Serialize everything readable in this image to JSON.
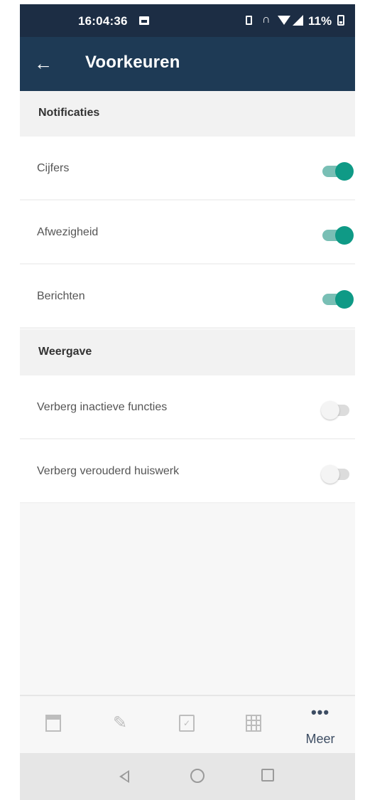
{
  "status_bar": {
    "time": "16:04:36",
    "battery": "11%",
    "icons": [
      "image-icon",
      "vibrate-icon",
      "headset-icon",
      "wifi-icon",
      "signal-icon",
      "battery-icon"
    ]
  },
  "app_bar": {
    "title": "Voorkeuren",
    "back_icon": "arrow-left-icon",
    "back_glyph": "←",
    "background": "#1e3a55"
  },
  "sections": [
    {
      "header": "Notificaties",
      "items": [
        {
          "label": "Cijfers",
          "enabled": true
        },
        {
          "label": "Afwezigheid",
          "enabled": true
        },
        {
          "label": "Berichten",
          "enabled": true
        }
      ]
    },
    {
      "header": "Weergave",
      "items": [
        {
          "label": "Verberg inactieve functies",
          "enabled": false
        },
        {
          "label": "Verberg verouderd huiswerk",
          "enabled": false
        }
      ]
    }
  ],
  "bottom_nav": {
    "items": [
      {
        "icon": "agenda-icon"
      },
      {
        "icon": "pencil-icon",
        "glyph": "✎"
      },
      {
        "icon": "task-check-icon",
        "glyph": "✓"
      },
      {
        "icon": "grid-icon"
      },
      {
        "icon": "more-icon",
        "glyph": "•••",
        "label": "Meer"
      }
    ]
  },
  "colors": {
    "accent": "#0f9a86",
    "accent_track": "#79bfb5",
    "toggle_off_track": "#dcdcdc",
    "toggle_off_thumb": "#f4f4f4",
    "section_bg": "#f2f2f2"
  }
}
